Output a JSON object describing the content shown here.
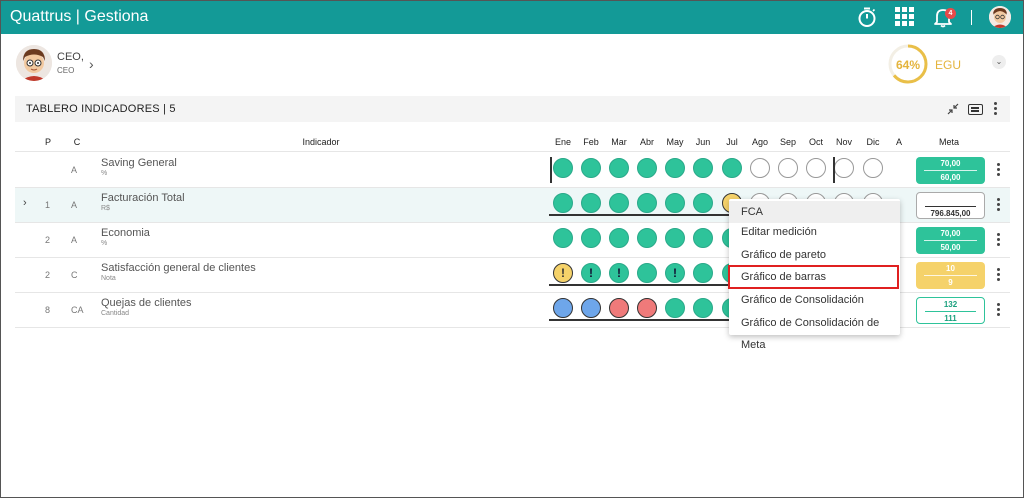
{
  "app": {
    "title": "Quattrus | Gestiona",
    "notification_count": "4"
  },
  "profile": {
    "name": "CEO,",
    "role": "CEO",
    "score": "64%",
    "score_value": 0.64,
    "unit": "EGU"
  },
  "section": {
    "title": "TABLERO INDICADORES | 5"
  },
  "columns": {
    "p": "P",
    "c": "C",
    "indicator": "Indicador",
    "months": [
      "Ene",
      "Feb",
      "Mar",
      "Abr",
      "May",
      "Jun",
      "Jul",
      "Ago",
      "Sep",
      "Oct",
      "Nov",
      "Dic"
    ],
    "a": "A",
    "meta": "Meta"
  },
  "rows": [
    {
      "p": "",
      "c": "A",
      "name": "Saving General",
      "unit": "%",
      "statuses": [
        "green",
        "green",
        "green",
        "green",
        "green",
        "green",
        "green",
        "empty",
        "empty",
        "empty",
        "empty",
        "empty"
      ],
      "meta_style": "green",
      "meta_top": "70,00",
      "meta_bottom": "60,00"
    },
    {
      "p": "1",
      "c": "A",
      "name": "Facturación Total",
      "unit": "R$",
      "statuses": [
        "green",
        "green",
        "green",
        "green",
        "green",
        "green",
        "yellow",
        "empty",
        "empty",
        "empty",
        "empty",
        "empty"
      ],
      "meta_style": "outline",
      "meta_top": "",
      "meta_bottom": "796.845,00"
    },
    {
      "p": "2",
      "c": "A",
      "name": "Economia",
      "unit": "%",
      "statuses": [
        "green",
        "green",
        "green",
        "green",
        "green",
        "green",
        "green"
      ],
      "meta_style": "green",
      "meta_top": "70,00",
      "meta_bottom": "50,00"
    },
    {
      "p": "2",
      "c": "C",
      "name": "Satisfacción general de clientes",
      "unit": "Nota",
      "statuses": [
        "yellow-alert",
        "green-alert",
        "green-alert",
        "green",
        "green-alert",
        "green",
        "green-alert"
      ],
      "meta_style": "yellow",
      "meta_top": "10",
      "meta_bottom": "9"
    },
    {
      "p": "8",
      "c": "CA",
      "name": "Quejas de clientes",
      "unit": "Cantidad",
      "statuses": [
        "blue",
        "blue",
        "red",
        "red",
        "green",
        "green",
        "green"
      ],
      "meta_style": "outline-green",
      "meta_top": "132",
      "meta_bottom": "111"
    }
  ],
  "context_menu": {
    "items": [
      "FCA",
      "Editar medición",
      "Gráfico de pareto",
      "Gráfico de barras",
      "Gráfico de Consolidación",
      "Gráfico de Consolidación de Meta"
    ]
  },
  "colors": {
    "topbar": "#139a97",
    "green": "#2ec39a",
    "yellow": "#f5d26a",
    "blue": "#6ea6ea",
    "red": "#ef7a7a",
    "highlight": "#e02020"
  }
}
